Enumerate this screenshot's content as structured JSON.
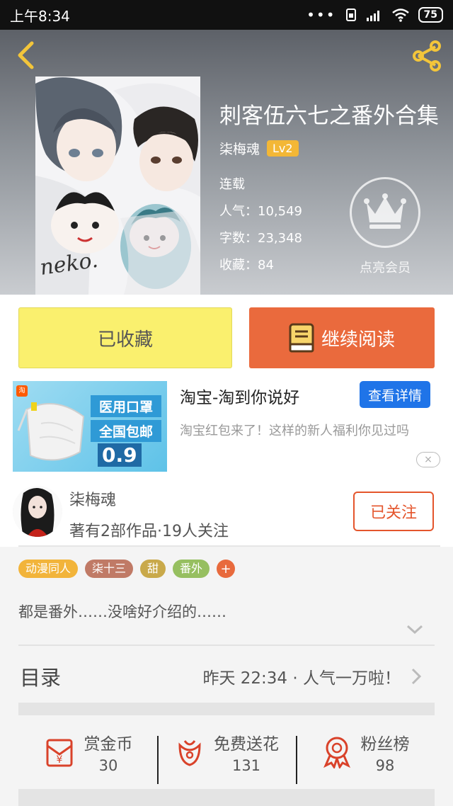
{
  "status_bar": {
    "time": "上午8:34",
    "battery": "75"
  },
  "book": {
    "title": "刺客伍六七之番外合集",
    "author": "柒梅魂",
    "level": "Lv2",
    "status": "连载",
    "popularity": "人气：10,549",
    "word_count": "字数：23,348",
    "favorites": "收藏：84",
    "cover_text": "neko.",
    "vip_label": "点亮会员"
  },
  "actions": {
    "collected_label": "已收藏",
    "continue_label": "继续阅读"
  },
  "ad": {
    "image_line1": "医用口罩",
    "image_line2": "全国包邮",
    "image_price": "0.9",
    "logo": "淘",
    "title": "淘宝-淘到你说好",
    "detail_button": "查看详情",
    "description": "淘宝红包来了！这样的新人福利你见过吗",
    "close_icon": "×"
  },
  "author_card": {
    "name": "柒梅魂",
    "info": "著有2部作品·19人关注",
    "follow_label": "已关注"
  },
  "tags": [
    {
      "label": "动漫同人",
      "color": "#f2b43a"
    },
    {
      "label": "柒十三",
      "color": "#c07a66"
    },
    {
      "label": "甜",
      "color": "#c9a94a"
    },
    {
      "label": "番外",
      "color": "#96bf60"
    }
  ],
  "tag_add": "+",
  "intro": "都是番外……没啥好介绍的……",
  "catalog": {
    "label": "目录",
    "latest": "昨天 22:34 · 人气一万啦！"
  },
  "stats": [
    {
      "label": "赏金币",
      "value": "30",
      "icon": "reward-coin-icon"
    },
    {
      "label": "免费送花",
      "value": "131",
      "icon": "flower-icon"
    },
    {
      "label": "粉丝榜",
      "value": "98",
      "icon": "medal-icon"
    }
  ],
  "colors": {
    "accent": "#ea6a3d",
    "collected_bg": "#faf06e",
    "ad_button": "#1f74e8",
    "level_badge": "#f3b736"
  }
}
